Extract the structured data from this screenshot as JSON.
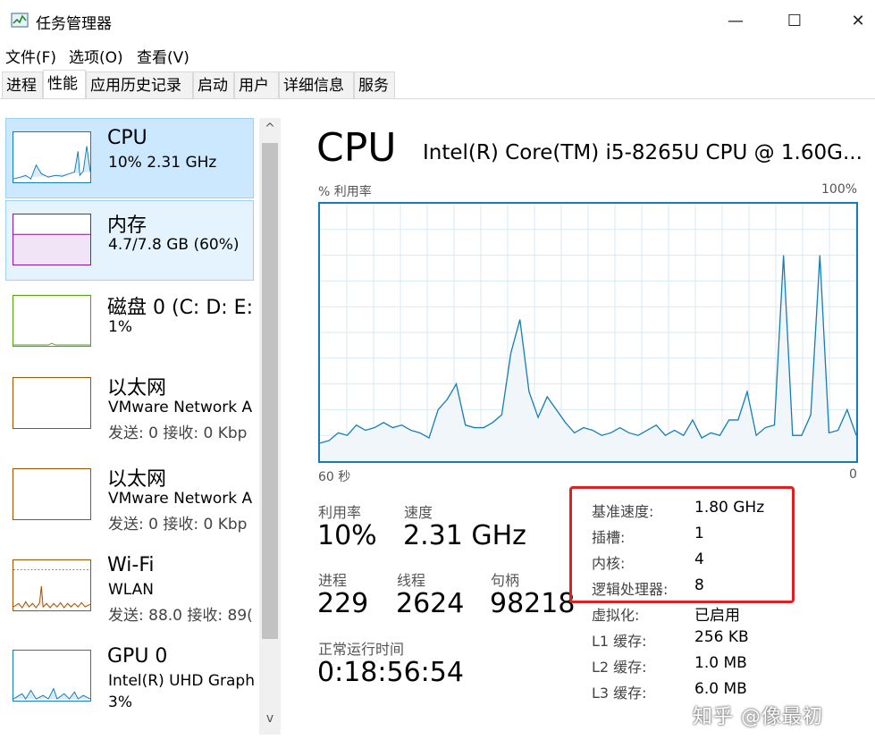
{
  "window": {
    "title": "任务管理器",
    "minimize_glyph": "—",
    "maximize_glyph": "☐",
    "close_glyph": "✕"
  },
  "menu": [
    "文件(F)",
    "选项(O)",
    "查看(V)"
  ],
  "tabs": [
    "进程",
    "性能",
    "应用历史记录",
    "启动",
    "用户",
    "详细信息",
    "服务"
  ],
  "active_tab": "性能",
  "sidebar": {
    "items": [
      {
        "title": "CPU",
        "sub": "10%  2.31 GHz",
        "sub2": "",
        "color": "#117dbb"
      },
      {
        "title": "内存",
        "sub": "4.7/7.8 GB (60%)",
        "sub2": "",
        "color": "#8b12ae"
      },
      {
        "title": "磁盘 0 (C: D: E:",
        "sub": "1%",
        "sub2": "",
        "color": "#4da60c"
      },
      {
        "title": "以太网",
        "sub": "VMware Network A",
        "sub2": "发送: 0 接收: 0 Kbp",
        "color": "#a74f01"
      },
      {
        "title": "以太网",
        "sub": "VMware Network A",
        "sub2": "发送: 0 接收: 0 Kbp",
        "color": "#a74f01"
      },
      {
        "title": "Wi-Fi",
        "sub": "WLAN",
        "sub2": "发送: 88.0 接收: 89(",
        "color": "#a74f01"
      },
      {
        "title": "GPU 0",
        "sub": "Intel(R) UHD Graph",
        "sub2": "3%",
        "color": "#117dbb"
      }
    ],
    "scroll_up_glyph": "^",
    "scroll_down_glyph": "v"
  },
  "main": {
    "heading": "CPU",
    "model": "Intel(R) Core(TM) i5-8265U CPU @ 1.60G...",
    "graph": {
      "ylabel": "% 利用率",
      "ymax_label": "100%",
      "x_left_label": "60 秒",
      "x_right_label": "0"
    },
    "stats": {
      "utilization_label": "利用率",
      "utilization_value": "10%",
      "speed_label": "速度",
      "speed_value": "2.31 GHz",
      "processes_label": "进程",
      "processes_value": "229",
      "threads_label": "线程",
      "threads_value": "2624",
      "handles_label": "句柄",
      "handles_value": "98218",
      "uptime_label": "正常运行时间",
      "uptime_value": "0:18:56:54"
    },
    "info": [
      {
        "label": "基准速度:",
        "value": "1.80 GHz"
      },
      {
        "label": "插槽:",
        "value": "1"
      },
      {
        "label": "内核:",
        "value": "4"
      },
      {
        "label": "逻辑处理器:",
        "value": "8"
      },
      {
        "label": "虚拟化:",
        "value": "已启用"
      },
      {
        "label": "L1 缓存:",
        "value": "256 KB"
      },
      {
        "label": "L2 缓存:",
        "value": "1.0 MB"
      },
      {
        "label": "L3 缓存:",
        "value": "6.0 MB"
      }
    ]
  },
  "chart_data": {
    "type": "area",
    "title": "",
    "xlabel": "",
    "ylabel": "% 利用率",
    "xlim": [
      60,
      0
    ],
    "ylim": [
      0,
      100
    ],
    "series": [
      {
        "values": [
          7,
          8,
          11,
          10,
          14,
          12,
          13,
          15,
          13,
          14,
          12,
          11,
          9,
          20,
          24,
          30,
          14,
          13,
          13,
          15,
          18,
          42,
          55,
          27,
          17,
          25,
          20,
          15,
          11,
          13,
          12,
          10,
          11,
          13,
          11,
          10,
          12,
          14,
          10,
          12,
          10,
          16,
          9,
          11,
          10,
          16,
          16,
          27,
          10,
          13,
          14,
          80,
          10,
          10,
          18,
          80,
          11,
          12,
          20,
          10
        ]
      }
    ],
    "grid": true
  },
  "watermark": "知乎 @像最初"
}
